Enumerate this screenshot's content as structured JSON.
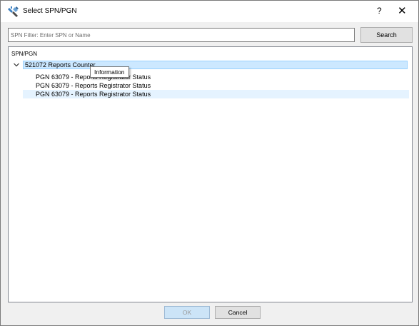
{
  "window": {
    "title": "Select SPN/PGN",
    "help_glyph": "?",
    "close_glyph": "✕",
    "icon": "tools-icon"
  },
  "filter": {
    "placeholder": "SPN Filter: Enter SPN or Name",
    "value": "",
    "search_label": "Search"
  },
  "tree": {
    "header": "SPN/PGN",
    "root": {
      "label": "521072 Reports Counter",
      "expanded": true,
      "children": [
        {
          "label": "PGN 63079 - Reports Registrator Status"
        },
        {
          "label": "PGN 63079 - Reports Registrator Status"
        },
        {
          "label": "PGN 63079 - Reports Registrator Status"
        }
      ]
    }
  },
  "tooltip": {
    "text": "Information"
  },
  "buttons": {
    "ok_label": "OK",
    "cancel_label": "Cancel"
  },
  "colors": {
    "selection": "#cce8ff",
    "selection_border": "#99d1ff",
    "hover": "#e5f3ff",
    "ok_button": "#cce4f7"
  }
}
